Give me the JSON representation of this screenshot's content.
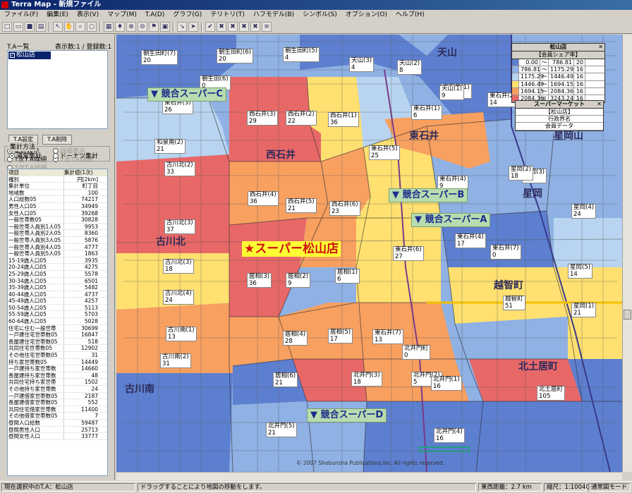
{
  "title": "Terra Map - 新規ファイル",
  "menu": [
    "ファイル(F)",
    "編集(E)",
    "表示(V)",
    "マップ(M)",
    "T.A(D)",
    "グラフ(G)",
    "テリトリ(T)",
    "ハフモデル(B)",
    "シンボル(S)",
    "オプション(O)",
    "ヘルプ(H)"
  ],
  "panel": {
    "list_title": "T.A一覧",
    "list_count": "表示数:1 / 登録数:1",
    "list_item": "松山店",
    "btn_set": "T.A設定",
    "btn_del": "T.A削除",
    "radios": [
      {
        "label": "集計表示",
        "on": true,
        "disabled": false
      },
      {
        "label": "詳細表示",
        "on": false,
        "disabled": true
      },
      {
        "label": "1次T.A詳細",
        "on": false,
        "disabled": false
      },
      {
        "label": "2次T.A詳細",
        "on": false,
        "disabled": true
      },
      {
        "label": "3次T.A詳細",
        "on": false,
        "disabled": true
      }
    ],
    "group_title": "集計方法",
    "group_opts": [
      {
        "label": "通常集計",
        "on": true
      },
      {
        "label": "ドーナツ集計",
        "on": false
      }
    ]
  },
  "table": {
    "headers": [
      "項目",
      "集計値(1次)"
    ],
    "rows": [
      [
        "種別",
        "円[2km]"
      ],
      [
        "集計単位",
        "町丁目"
      ],
      [
        "地域数",
        "100"
      ],
      [
        "人口総数05",
        "74217"
      ],
      [
        "男性人口05",
        "34949"
      ],
      [
        "女性人口05",
        "39268"
      ],
      [
        "一般世帯数05",
        "30828"
      ],
      [
        "一般世帯人員別1人05",
        "9953"
      ],
      [
        "一般世帯人員別2人05",
        "8360"
      ],
      [
        "一般世帯人員別3人05",
        "5876"
      ],
      [
        "一般世帯人員別4人05",
        "4777"
      ],
      [
        "一般世帯人員別5人05",
        "1863"
      ],
      [
        "15-19歳人口05",
        "3935"
      ],
      [
        "20-24歳人口05",
        "4275"
      ],
      [
        "25-29歳人口05",
        "5578"
      ],
      [
        "30-34歳人口05",
        "6501"
      ],
      [
        "35-39歳人口05",
        "5482"
      ],
      [
        "40-44歳人口05",
        "4737"
      ],
      [
        "45-49歳人口05",
        "4257"
      ],
      [
        "50-54歳人口05",
        "5113"
      ],
      [
        "55-59歳人口05",
        "5703"
      ],
      [
        "60-64歳人口05",
        "5028"
      ],
      [
        "住宅に住む一般世帯",
        "30699"
      ],
      [
        "一戸建住宅世帯数05",
        "16847"
      ],
      [
        "長屋建住宅世帯数05",
        "518"
      ],
      [
        "共同住宅世帯数05",
        "12902"
      ],
      [
        "その他住宅世帯数05",
        "31"
      ],
      [
        "持ち家世帯数05",
        "14449"
      ],
      [
        "一戸建持ち家世帯数",
        "14660"
      ],
      [
        "長屋建持ち家世帯数",
        "48"
      ],
      [
        "共同住宅持ち家世帯",
        "1502"
      ],
      [
        "その他持ち家世帯数",
        "24"
      ],
      [
        "一戸建借家世帯数05",
        "2187"
      ],
      [
        "長屋建借家世帯数05",
        "552"
      ],
      [
        "共同住宅借家世帯数",
        "11400"
      ],
      [
        "その他借家世帯数05",
        "7"
      ],
      [
        "昼間人口総数",
        "59487"
      ],
      [
        "昼間男性人口",
        "25713"
      ],
      [
        "昼間女性人口",
        "33777"
      ]
    ]
  },
  "map": {
    "main_store": "スーパー松山店",
    "competitors": [
      "競合スーパーC",
      "競合スーパーB",
      "競合スーパーA",
      "競合スーパーD"
    ],
    "area_names": [
      "西石井",
      "古川北",
      "東石井",
      "星岡",
      "天山",
      "星岡山",
      "越智町",
      "北土居町",
      "古川南"
    ],
    "labels": [
      [
        "朝生田町(7)",
        "20"
      ],
      [
        "朝生田町(6)",
        "20"
      ],
      [
        "朝生田町(5)",
        "4"
      ],
      [
        "天山(3)",
        "4"
      ],
      [
        "天山(2)",
        "8"
      ],
      [
        "朝生田(6)",
        "0"
      ],
      [
        "西石井(3)",
        "29"
      ],
      [
        "西石井(2)",
        "22"
      ],
      [
        "西石井(1)",
        "36"
      ],
      [
        "東石井(3)",
        "26"
      ],
      [
        "東石井(1)",
        "3"
      ],
      [
        "東石井(2)",
        "14"
      ],
      [
        "和泉南(2)",
        "21"
      ],
      [
        "古川北(2)",
        "33"
      ],
      [
        "東石井(5)",
        "25"
      ],
      [
        "東石井(4)",
        "9"
      ],
      [
        "西石井(4)",
        "36"
      ],
      [
        "西石井(5)",
        "21"
      ],
      [
        "西石井(6)",
        "23"
      ],
      [
        "古川北(3)",
        "37"
      ],
      [
        "東石井(4)",
        "17"
      ],
      [
        "東石井(6)",
        "27"
      ],
      [
        "東石井(7)",
        "0"
      ],
      [
        "古川北(3)",
        "18"
      ],
      [
        "居相(3)",
        "36"
      ],
      [
        "居相(2)",
        "9"
      ],
      [
        "居相(1)",
        "6"
      ],
      [
        "古川北(4)",
        "24"
      ],
      [
        "越智町",
        "51"
      ],
      [
        "古川南(1)",
        "13"
      ],
      [
        "居相(4)",
        "28"
      ],
      [
        "居相(5)",
        "17"
      ],
      [
        "東石井(7)",
        "13"
      ],
      [
        "古川南(2)",
        "31"
      ],
      [
        "北井門町",
        "0"
      ],
      [
        "居相(6)",
        "21"
      ],
      [
        "北井門(3)",
        "18"
      ],
      [
        "北井門(2)",
        "5"
      ],
      [
        "北井門(1)",
        "16"
      ],
      [
        "北土居町",
        "105"
      ],
      [
        "北井門(5)",
        "21"
      ],
      [
        "北井門(4)",
        "16"
      ],
      [
        "天山(1)",
        "9"
      ],
      [
        "東石井(1)",
        "6"
      ],
      [
        "星岡(3)",
        "16"
      ],
      [
        "星岡(4)",
        "24"
      ],
      [
        "星岡(5)",
        "14"
      ],
      [
        "星岡(2)",
        "18"
      ],
      [
        "星岡(1)",
        "21"
      ]
    ],
    "copyright": "© 2007 Shobunsha Publications,Inc. All rights reserved."
  },
  "legend1": {
    "title": "松山店",
    "subtitle": "【会員シェア率】",
    "rows": [
      [
        "0.00",
        "～",
        "786.81",
        "20"
      ],
      [
        "786.81",
        "～",
        "1175.29",
        "16"
      ],
      [
        "1175.29",
        "～",
        "1446.49",
        "16"
      ],
      [
        "1446.49",
        "～",
        "1694.15",
        "16"
      ],
      [
        "1694.15",
        "～",
        "2084.36",
        "16"
      ],
      [
        "2084.36",
        "≦",
        "3243.24",
        "16"
      ]
    ],
    "colors": [
      "#5d7fd0",
      "#8fb1e4",
      "#b8d4f0",
      "#ffe070",
      "#f8a060",
      "#e86868"
    ]
  },
  "legend2": {
    "title": "スーパーマーケット",
    "rows": [
      "【松山店】",
      "行政界名",
      "会員データ"
    ]
  },
  "status": {
    "selected": "現在選択中のT.A：松山店",
    "hint": "ドラッグすることにより地図の移動をします。",
    "dist": "東西距離：2.7 km",
    "scale": "縮尺：1:10040",
    "mode": "通常図モード"
  },
  "colors": {
    "title_bar": "#0a246a",
    "main_store_bg": "#ffff33",
    "main_store_text": "#d01010",
    "competitor_bg": "#b8dcb0"
  }
}
